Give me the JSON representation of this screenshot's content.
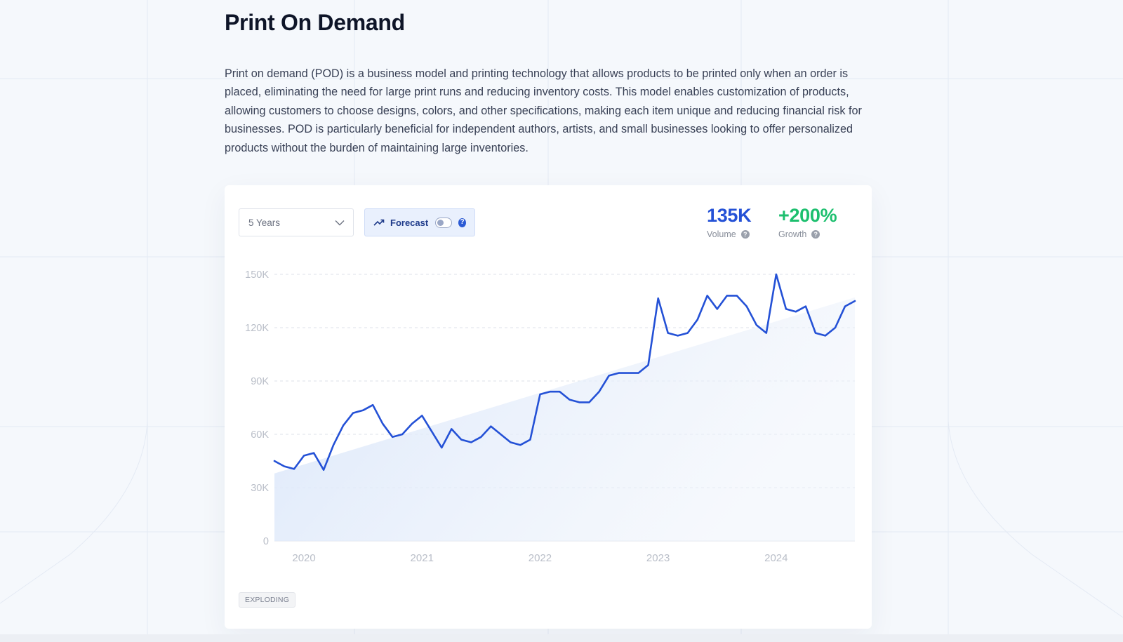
{
  "page": {
    "title": "Print On Demand",
    "description": "Print on demand (POD) is a business model and printing technology that allows products to be printed only when an order is placed, eliminating the need for large print runs and reducing inventory costs. This model enables customization of products, allowing customers to choose designs, colors, and other specifications, making each item unique and reducing financial risk for businesses. POD is particularly beneficial for independent authors, artists, and small businesses looking to offer personalized products without the burden of maintaining large inventories."
  },
  "controls": {
    "range_selected": "5 Years",
    "forecast_label": "Forecast",
    "forecast_enabled": false
  },
  "stats": {
    "volume_value": "135K",
    "volume_label": "Volume",
    "growth_value": "+200%",
    "growth_label": "Growth"
  },
  "badge": "EXPLODING",
  "colors": {
    "line": "#2451d6",
    "trend_fill": "#dce8fa",
    "growth": "#1cbf6e",
    "grid": "#dde2ea",
    "tick": "#b9bec8"
  },
  "chart_data": {
    "type": "line",
    "x_start": 2019.75,
    "x_end": 2024.667,
    "y_range": [
      0,
      150000
    ],
    "y_ticks": [
      0,
      30000,
      60000,
      90000,
      120000,
      150000
    ],
    "y_tick_labels": [
      "0",
      "30K",
      "60K",
      "90K",
      "120K",
      "150K"
    ],
    "x_tick_labels": [
      "2020",
      "2021",
      "2022",
      "2023",
      "2024"
    ],
    "grid": "horizontal-dashed",
    "series": [
      {
        "values": [
          45000,
          42000,
          40500,
          48000,
          49500,
          40000,
          54000,
          65000,
          72000,
          73500,
          76500,
          66000,
          58500,
          60000,
          66000,
          70500,
          61500,
          52500,
          63000,
          57000,
          55500,
          58500,
          64500,
          60000,
          55500,
          54000,
          57000,
          82500,
          84000,
          84000,
          79500,
          78000,
          78000,
          84000,
          93000,
          94500,
          94500,
          94500,
          99000,
          136500,
          117000,
          115500,
          117000,
          124500,
          138000,
          130500,
          138000,
          138000,
          132000,
          121500,
          117000,
          150000,
          130500,
          129000,
          132000,
          117000,
          115500,
          120000,
          132000,
          135000
        ]
      }
    ],
    "trend": {
      "start": 38000,
      "end": 137000
    }
  }
}
